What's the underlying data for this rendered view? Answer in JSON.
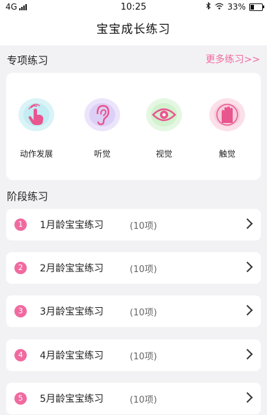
{
  "status": {
    "network": "4G",
    "time": "10:25",
    "battery": "33%"
  },
  "nav": {
    "title": "宝宝成长练习"
  },
  "special": {
    "title": "专项练习",
    "more": "更多练习>>",
    "items": [
      {
        "label": "动作发展",
        "icon": "hand-tap-icon"
      },
      {
        "label": "听觉",
        "icon": "ear-icon"
      },
      {
        "label": "视觉",
        "icon": "eye-icon"
      },
      {
        "label": "触觉",
        "icon": "touch-hand-icon"
      }
    ]
  },
  "stages": {
    "title": "阶段练习",
    "items": [
      {
        "num": "1",
        "title": "1月龄宝宝练习",
        "count": "(10项)"
      },
      {
        "num": "2",
        "title": "2月龄宝宝练习",
        "count": "(10项)"
      },
      {
        "num": "3",
        "title": "3月龄宝宝练习",
        "count": "(10项)"
      },
      {
        "num": "4",
        "title": "4月龄宝宝练习",
        "count": "(10项)"
      },
      {
        "num": "5",
        "title": "5月龄宝宝练习",
        "count": "(10项)"
      }
    ]
  },
  "colors": {
    "accent": "#f06aa0",
    "background": "#f2f2f4"
  }
}
